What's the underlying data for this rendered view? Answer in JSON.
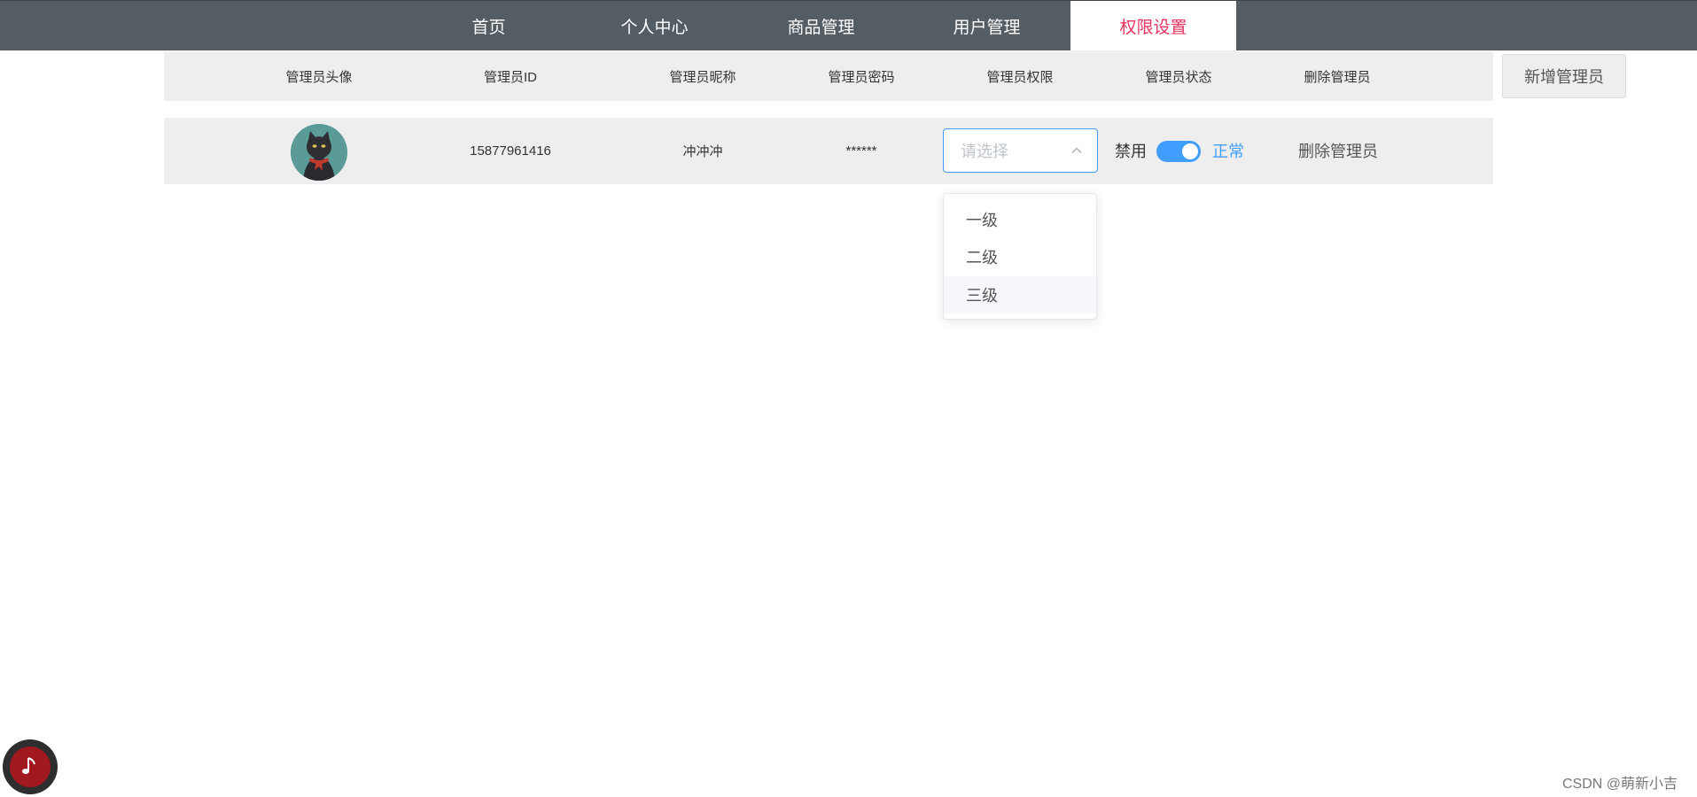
{
  "nav": {
    "items": [
      "首页",
      "个人中心",
      "商品管理",
      "用户管理",
      "权限设置"
    ],
    "active_index": 4
  },
  "table": {
    "headers": [
      "管理员头像",
      "管理员ID",
      "管理员昵称",
      "管理员密码",
      "管理员权限",
      "管理员状态",
      "删除管理员"
    ],
    "row": {
      "id": "15877961416",
      "nickname": "冲冲冲",
      "password": "******",
      "permission_placeholder": "请选择",
      "status_off_label": "禁用",
      "status_on_label": "正常",
      "status_on": true,
      "delete_label": "删除管理员"
    }
  },
  "add_button": "新增管理员",
  "permission_options": [
    "一级",
    "二级",
    "三级"
  ],
  "hovered_option_index": 2,
  "watermark": "CSDN @萌新小吉",
  "colors": {
    "nav_bg": "#545c64",
    "nav_active_text": "#e9335f",
    "accent": "#409eff",
    "row_bg": "#eeeeee"
  },
  "icons": {
    "avatar": "black-cat-avatar",
    "select_arrow": "chevron-up-icon",
    "music": "music-note-icon"
  }
}
